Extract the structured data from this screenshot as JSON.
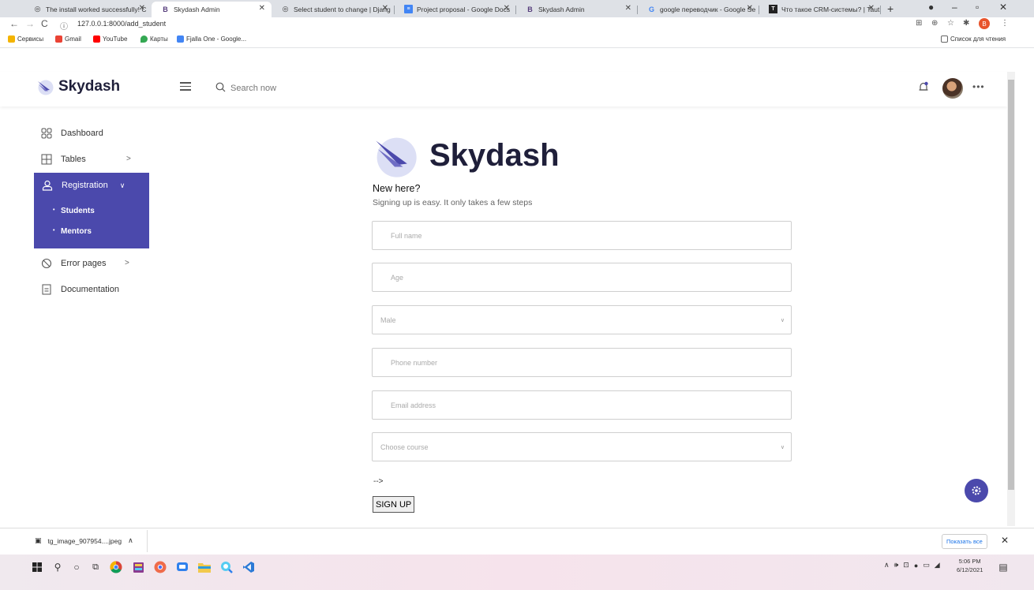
{
  "browser": {
    "tabs": [
      {
        "title": "The install worked successfully! C",
        "icon": "globe-icon"
      },
      {
        "title": "Skydash Admin",
        "icon": "bootstrap-icon"
      },
      {
        "title": "Select student to change | Djang",
        "icon": "globe-icon"
      },
      {
        "title": "Project proposal - Google Docs",
        "icon": "docs-icon"
      },
      {
        "title": "Skydash Admin",
        "icon": "bootstrap-icon"
      },
      {
        "title": "google переводчик - Google Se",
        "icon": "google-icon"
      },
      {
        "title": "Что такое CRM-системы? | Taut",
        "icon": "tilda-icon"
      }
    ],
    "new_tab": "+",
    "url": "127.0.0.1:8000/add_student",
    "bookmarks": [
      {
        "label": "Сервисы",
        "color": "#f4b400"
      },
      {
        "label": "Gmail",
        "color": "#ea4335"
      },
      {
        "label": "YouTube",
        "color": "#ff0000"
      },
      {
        "label": "Карты",
        "color": "#34a853"
      },
      {
        "label": "Fjalla One - Google...",
        "color": "#4285f4"
      }
    ],
    "reading_list": "Список для чтения",
    "profile_badge": "B"
  },
  "navbar": {
    "brand": "Skydash",
    "search_placeholder": "Search now",
    "more": "•••"
  },
  "sidebar": {
    "dashboard": "Dashboard",
    "tables": "Tables",
    "registration": "Registration",
    "students": "Students",
    "mentors": "Mentors",
    "error_pages": "Error pages",
    "documentation": "Documentation"
  },
  "form": {
    "brand": "Skydash",
    "heading": "New here?",
    "subheading": "Signing up is easy. It only takes a few steps",
    "full_name_placeholder": "Full name",
    "age_placeholder": "Age",
    "gender_selected": "Male",
    "phone_placeholder": "Phone number",
    "email_placeholder": "Email address",
    "course_selected": "Choose course",
    "stray_text": "-->",
    "submit_label": "SIGN UP"
  },
  "downloads": {
    "file": "tg_image_907954....jpeg",
    "show_all": "Показать все"
  },
  "taskbar": {
    "time": "5:06 PM",
    "date": "6/12/2021"
  },
  "colors": {
    "accent": "#4b49ac",
    "brand_text": "#1f1f3a"
  }
}
